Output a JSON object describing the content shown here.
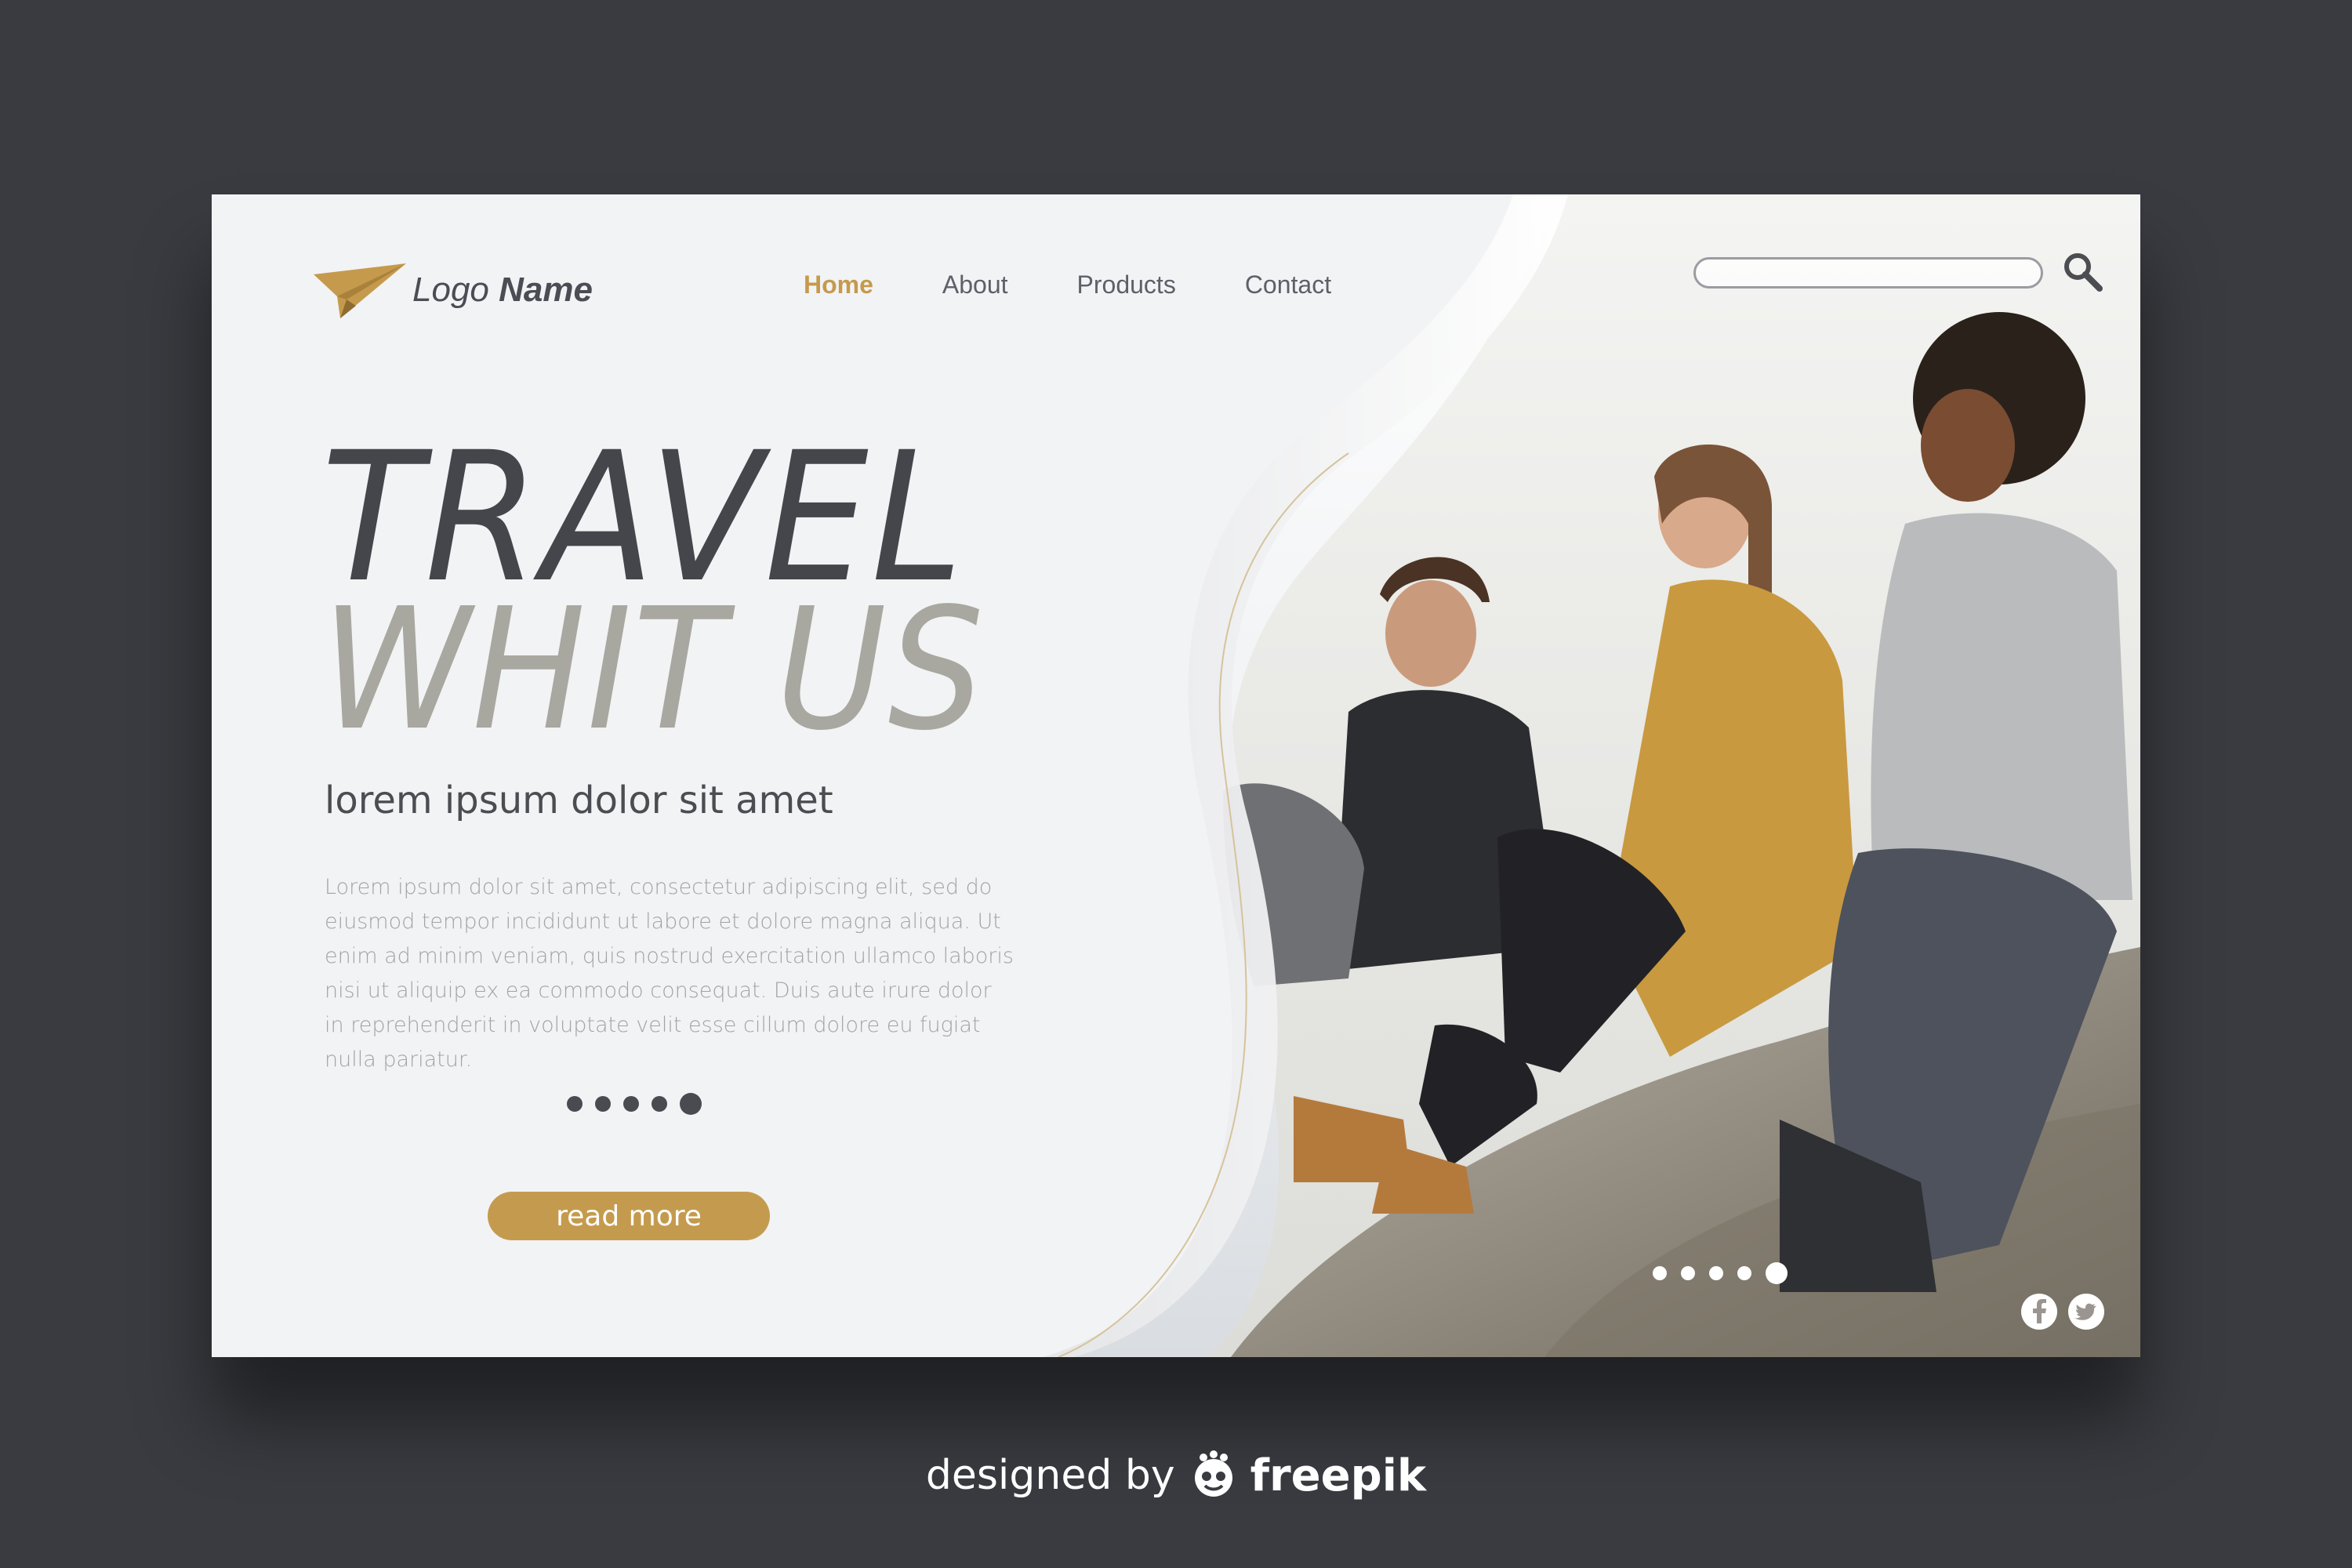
{
  "logo": {
    "text_light": "Logo",
    "text_bold": "Name",
    "icon": "paper-plane-icon"
  },
  "nav": {
    "items": [
      {
        "label": "Home",
        "active": true
      },
      {
        "label": "About",
        "active": false
      },
      {
        "label": "Products",
        "active": false
      },
      {
        "label": "Contact",
        "active": false
      }
    ]
  },
  "search": {
    "value": "",
    "icon": "search-icon"
  },
  "hero": {
    "headline_line1": "TRAVEL",
    "headline_line2": "WHIT US",
    "subtitle": "lorem ipsum dolor sit amet",
    "body": "Lorem ipsum dolor sit amet, consectetur adipiscing elit, sed do eiusmod tempor incididunt ut labore et dolore magna aliqua. Ut enim ad minim veniam, quis nostrud exercitation ullamco laboris nisi ut aliquip ex ea commodo consequat. Duis aute irure dolor in reprehenderit in voluptate velit esse cillum dolore eu fugiat nulla pariatur.",
    "cta_label": "read more",
    "slider_dots": 5,
    "active_dot": 5
  },
  "photo": {
    "slider_dots": 5,
    "active_dot": 5
  },
  "social": [
    {
      "icon": "facebook-icon"
    },
    {
      "icon": "twitter-icon"
    }
  ],
  "credit": {
    "text": "designed by",
    "brand": "freepik",
    "icon": "freepik-mascot-icon"
  },
  "colors": {
    "accent": "#c49b4e",
    "background": "#3a3b40",
    "headline_dark": "#45464b",
    "headline_light": "#a8a7a0",
    "text_gray": "#a3a3a5"
  }
}
